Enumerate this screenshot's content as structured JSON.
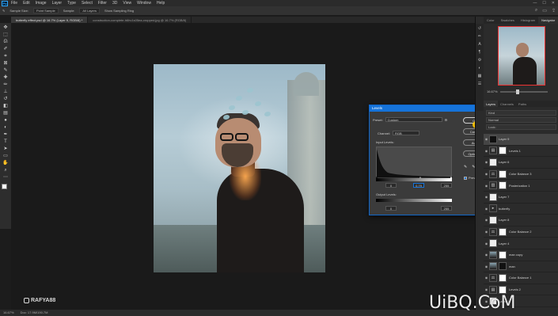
{
  "app": {
    "logo_text": "Ps",
    "menu": [
      "File",
      "Edit",
      "Image",
      "Layer",
      "Type",
      "Select",
      "Filter",
      "3D",
      "View",
      "Window",
      "Help"
    ],
    "window_controls": [
      "—",
      "☐",
      "✕"
    ]
  },
  "options_bar": {
    "sample_size_label": "Sample Size:",
    "sample_size_value": "Point Sample",
    "sample_label": "Sample:",
    "sample_value": "All Layers",
    "show_ring": "Show Sampling Ring"
  },
  "tabs": [
    {
      "label": "butterfly effect.psd @ 16.7% (Layer 9, RGB/8) *",
      "active": true
    },
    {
      "label": "construction-complete-h6hv1s05ea-cropped.jpg @ 16.7% (RGB/8)",
      "active": false
    }
  ],
  "toolbar": {
    "tools": [
      "move",
      "marquee",
      "lasso",
      "quick-select",
      "crop",
      "frame",
      "eyedropper",
      "healing",
      "brush",
      "stamp",
      "history-brush",
      "eraser",
      "gradient",
      "blur",
      "dodge",
      "pen",
      "type",
      "path-select",
      "shape",
      "hand",
      "zoom",
      "more"
    ],
    "fg_color": "#ffffff",
    "bg_color": "#2a5ed8"
  },
  "levels_dialog": {
    "title": "Levels",
    "close": "✕",
    "preset_label": "Preset:",
    "preset_value": "Custom",
    "channel_label": "Channel:",
    "channel_value": "RGB",
    "input_levels_label": "Input Levels:",
    "input_values": [
      "0",
      "0,79",
      "255"
    ],
    "output_levels_label": "Output Levels:",
    "output_values": [
      "0",
      "255"
    ],
    "buttons": [
      "OK",
      "Cancel",
      "Auto",
      "Options..."
    ],
    "preview_label": "Preview",
    "preview_checked": true,
    "eyedroppers": [
      "black-eyedropper",
      "gray-eyedropper",
      "white-eyedropper"
    ]
  },
  "navigator": {
    "tabs": [
      "Color",
      "Swatches",
      "Histogram",
      "Navigator"
    ],
    "active": "Navigator",
    "zoom": "16.67%"
  },
  "layers_panel": {
    "tabs": [
      "Layers",
      "Channels",
      "Paths"
    ],
    "active": "Layers",
    "controls": [
      "Kind",
      "Normal",
      "Lock:"
    ],
    "layers": [
      {
        "name": "Layer 9",
        "thumb": "dark",
        "mask": "",
        "selected": true
      },
      {
        "name": "Levels 1",
        "thumb": "adj",
        "mask": "white",
        "selected": false
      },
      {
        "name": "Layer 6",
        "thumb": "white",
        "mask": "",
        "selected": false
      },
      {
        "name": "Color Balance 3",
        "thumb": "adj",
        "mask": "white",
        "selected": false
      },
      {
        "name": "Posterization 1",
        "thumb": "adj",
        "mask": "white",
        "selected": false
      },
      {
        "name": "Layer 7",
        "thumb": "white",
        "mask": "",
        "selected": false
      },
      {
        "name": "butterfly",
        "thumb": "group",
        "mask": "",
        "selected": false
      },
      {
        "name": "Layer 8",
        "thumb": "white",
        "mask": "",
        "selected": false
      },
      {
        "name": "Color Balance 2",
        "thumb": "adj",
        "mask": "white",
        "selected": false
      },
      {
        "name": "Layer 4",
        "thumb": "white",
        "mask": "",
        "selected": false
      },
      {
        "name": "man copy",
        "thumb": "photo",
        "mask": "white",
        "selected": false
      },
      {
        "name": "man",
        "thumb": "photo",
        "mask": "black",
        "selected": false
      },
      {
        "name": "Color Balance 1",
        "thumb": "adj",
        "mask": "white",
        "selected": false
      },
      {
        "name": "Levels 2",
        "thumb": "adj",
        "mask": "white",
        "selected": false
      },
      {
        "name": "Layer 1",
        "thumb": "white",
        "mask": "",
        "selected": false
      }
    ]
  },
  "status_bar": {
    "zoom": "16.67%",
    "doc": "Doc: 17.9M/190.7M"
  },
  "watermarks": {
    "rafya": "RAFYA88",
    "uibq": "UiBQ.CoM"
  }
}
